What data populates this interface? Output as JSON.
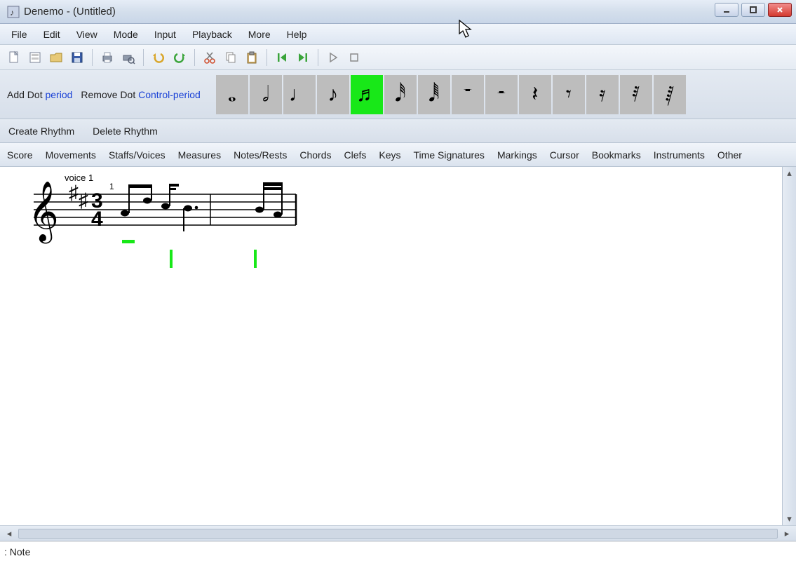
{
  "window": {
    "title": "Denemo - (Untitled)"
  },
  "menubar": {
    "items": [
      "File",
      "Edit",
      "View",
      "Mode",
      "Input",
      "Playback",
      "More",
      "Help"
    ]
  },
  "toolbar": {
    "buttons": [
      {
        "name": "new-file-icon"
      },
      {
        "name": "open-template-icon"
      },
      {
        "name": "open-folder-icon"
      },
      {
        "name": "save-icon"
      },
      {
        "name": "sep"
      },
      {
        "name": "print-icon"
      },
      {
        "name": "print-preview-icon"
      },
      {
        "name": "sep"
      },
      {
        "name": "undo-icon"
      },
      {
        "name": "redo-icon"
      },
      {
        "name": "sep"
      },
      {
        "name": "cut-icon"
      },
      {
        "name": "copy-icon"
      },
      {
        "name": "paste-icon"
      },
      {
        "name": "sep"
      },
      {
        "name": "go-start-icon"
      },
      {
        "name": "go-end-icon"
      },
      {
        "name": "sep"
      },
      {
        "name": "play-icon"
      },
      {
        "name": "stop-icon"
      }
    ]
  },
  "duration_palette": {
    "add_dot_label": "Add Dot",
    "add_dot_shortcut": "period",
    "remove_dot_label": "Remove Dot",
    "remove_dot_shortcut": "Control-period",
    "durations": [
      {
        "name": "whole-note",
        "glyph": "𝅝",
        "selected": false
      },
      {
        "name": "half-note",
        "glyph": "𝅗𝅥",
        "selected": false
      },
      {
        "name": "quarter-note",
        "glyph": "♩",
        "selected": false
      },
      {
        "name": "eighth-note",
        "glyph": "♪",
        "selected": false
      },
      {
        "name": "sixteenth-note",
        "glyph": "♬",
        "selected": true
      },
      {
        "name": "thirtysecond-note",
        "glyph": "𝅘𝅥𝅰",
        "selected": false
      },
      {
        "name": "sixtyfourth-note",
        "glyph": "𝅘𝅥𝅱",
        "selected": false
      },
      {
        "name": "whole-rest",
        "glyph": "𝄻",
        "selected": false
      },
      {
        "name": "half-rest",
        "glyph": "𝄼",
        "selected": false
      },
      {
        "name": "quarter-rest",
        "glyph": "𝄽",
        "selected": false
      },
      {
        "name": "eighth-rest",
        "glyph": "𝄾",
        "selected": false
      },
      {
        "name": "sixteenth-rest",
        "glyph": "𝄿",
        "selected": false
      },
      {
        "name": "thirtysecond-rest",
        "glyph": "𝅀",
        "selected": false
      },
      {
        "name": "sixtyfourth-rest",
        "glyph": "𝅁",
        "selected": false
      }
    ]
  },
  "rhythm_row": {
    "create_label": "Create Rhythm",
    "delete_label": "Delete Rhythm"
  },
  "tabs": {
    "items": [
      "Score",
      "Movements",
      "Staffs/Voices",
      "Measures",
      "Notes/Rests",
      "Chords",
      "Clefs",
      "Keys",
      "Time Signatures",
      "Markings",
      "Cursor",
      "Bookmarks",
      "Instruments",
      "Other"
    ]
  },
  "score": {
    "voice_label": "voice 1",
    "measure_number": "1",
    "time_signature": {
      "numerator": "3",
      "denominator": "4"
    },
    "key_sharps": 2,
    "clef": "treble"
  },
  "statusbar": {
    "text": ": Note"
  }
}
